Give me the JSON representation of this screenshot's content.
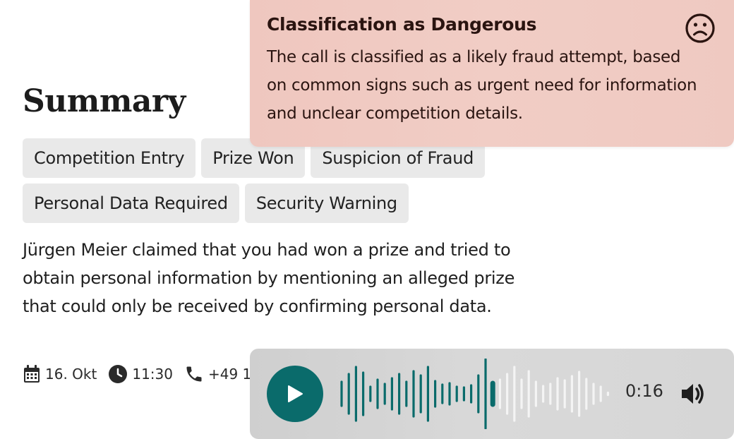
{
  "summary": {
    "title": "Summary",
    "tags_row1": [
      "Competition Entry",
      "Prize Won",
      "Suspicion of Fraud"
    ],
    "tags_row2": [
      "Personal Data Required",
      "Security Warning"
    ],
    "description": "Jürgen Meier claimed that you had won a prize and tried to obtain personal information by mentioning an alleged prize that could only be received by confirming personal data.",
    "meta": {
      "date": "16. Okt",
      "time": "11:30",
      "phone": "+49 1"
    }
  },
  "alert": {
    "title": "Classification as Dangerous",
    "text": "The call is classified as a likely fraud attempt, based on common signs such as urgent need for information and unclear competition details.",
    "icon": "sad-face-icon"
  },
  "player": {
    "elapsed": "0:16",
    "progress": 0.58,
    "colors": {
      "played": "#0a6b6b",
      "unplayed": "#f4f4f4",
      "button": "#0a6b6b"
    },
    "icons": [
      "play-icon",
      "volume-icon"
    ]
  }
}
